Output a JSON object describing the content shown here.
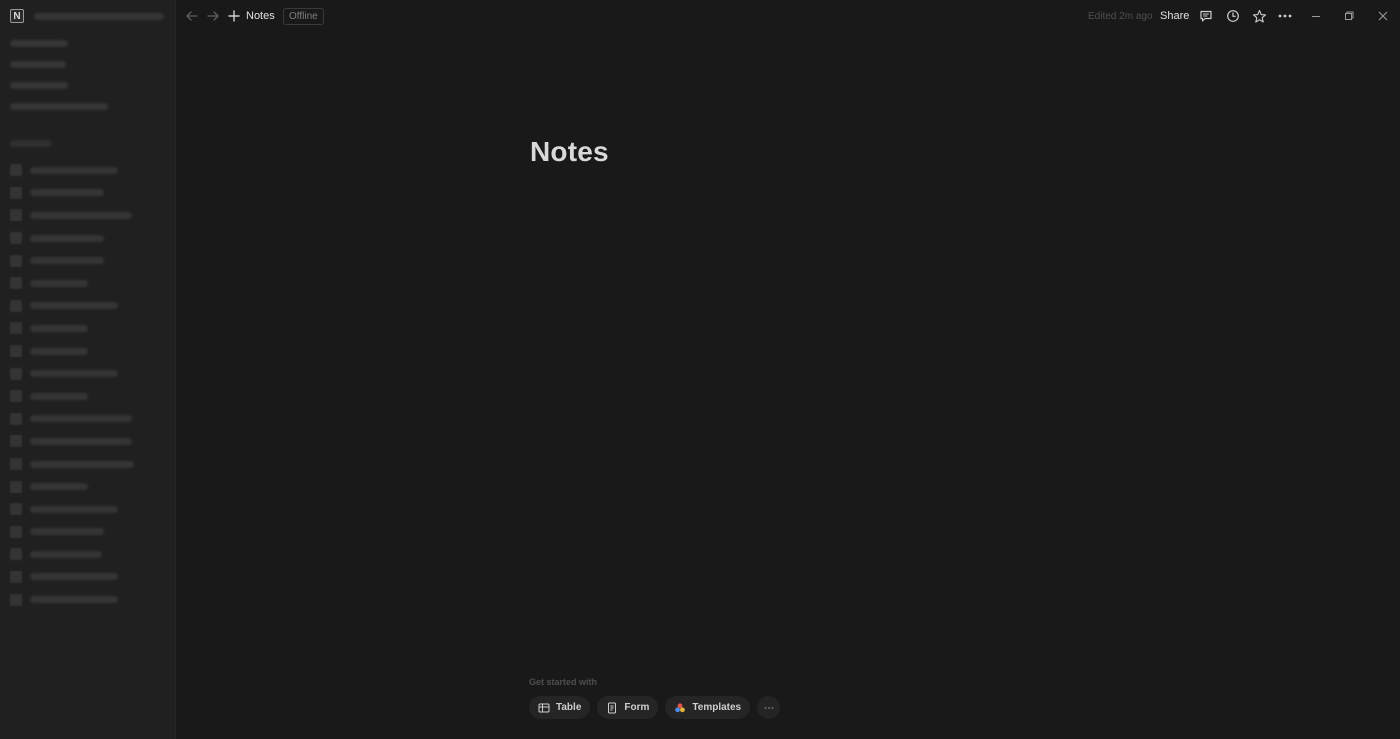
{
  "sidebar": {
    "logo_glyph": "N",
    "workspace_name_hidden": true,
    "nav_item_widths_hint": "blurred",
    "page_count": 20
  },
  "topbar": {
    "back_icon": "arrow-left-icon",
    "forward_icon": "arrow-right-icon",
    "add_icon": "plus-icon",
    "title": "Notes",
    "status_badge": "Offline",
    "edited": "Edited 2m ago",
    "share_label": "Share",
    "comments_icon": "comment-icon",
    "history_icon": "clock-icon",
    "favorite_icon": "star-icon",
    "more_icon": "more-horizontal-icon"
  },
  "window_controls": {
    "minimize_icon": "minimize-icon",
    "restore_icon": "restore-icon",
    "close_icon": "close-icon"
  },
  "page": {
    "title": "Notes"
  },
  "get_started": {
    "label": "Get started with",
    "options": [
      {
        "label": "Table",
        "icon": "table-icon"
      },
      {
        "label": "Form",
        "icon": "form-icon"
      },
      {
        "label": "Templates",
        "icon": "templates-icon"
      }
    ],
    "more_icon": "more-horizontal-icon"
  },
  "colors": {
    "background": "#191919",
    "sidebar": "#202020",
    "text": "#d9d9d9",
    "muted": "#4f4f4f"
  }
}
